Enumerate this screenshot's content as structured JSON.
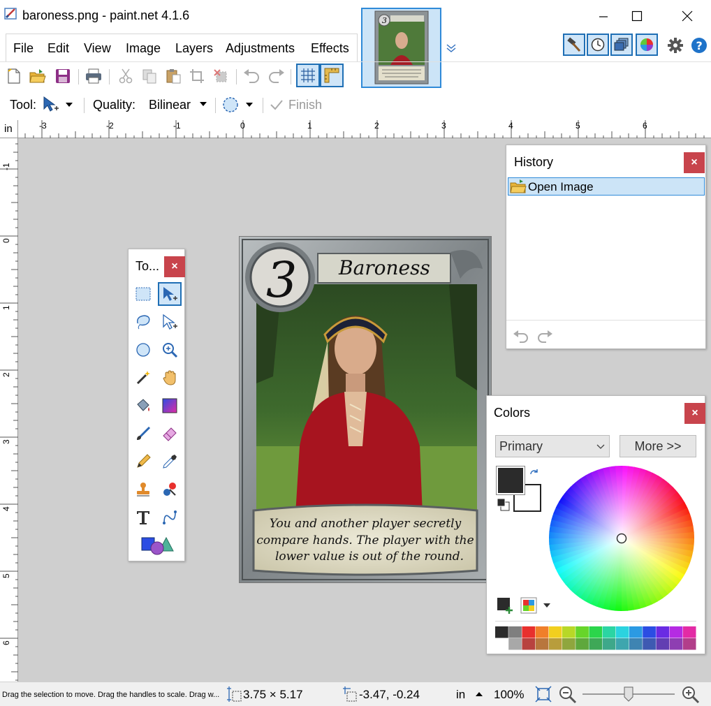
{
  "window": {
    "title": "baroness.png - paint.net 4.1.6",
    "minimize_label": "—",
    "maximize_label": "☐",
    "close_label": "✕"
  },
  "menu": [
    "File",
    "Edit",
    "View",
    "Image",
    "Layers",
    "Adjustments",
    "Effects"
  ],
  "tool_options": {
    "tool_label": "Tool:",
    "quality_label": "Quality:",
    "quality_value": "Bilinear",
    "finish_label": "Finish"
  },
  "ruler": {
    "unit": "in",
    "h_ticks": [
      "-3",
      "-2",
      "-1",
      "0",
      "1",
      "2",
      "3",
      "4",
      "5",
      "6"
    ],
    "v_ticks": [
      "-1",
      "0",
      "1",
      "2",
      "3",
      "4",
      "5",
      "6"
    ]
  },
  "card": {
    "number": "3",
    "name": "Baroness",
    "text_line1": "You and another player secretly",
    "text_line2": "compare hands. The player with the",
    "text_line3": "lower value is out of the round."
  },
  "tools_panel": {
    "title": "To...",
    "close": "×"
  },
  "history_panel": {
    "title": "History",
    "close": "×",
    "items": [
      "Open Image"
    ]
  },
  "colors_panel": {
    "title": "Colors",
    "close": "×",
    "selector_value": "Primary",
    "more_label": "More >>",
    "primary_color": "#2b2b2b",
    "secondary_color": "#ffffff",
    "palette_top": [
      "#2b2b2b",
      "#7f7f7f",
      "#e8302d",
      "#f07f2a",
      "#f2cf1f",
      "#b8d827",
      "#67d52a",
      "#2bd54b",
      "#2bd5a3",
      "#2bd3df",
      "#2b9ae3",
      "#2b4de3",
      "#6a2be3",
      "#b52be3",
      "#e32ba5"
    ],
    "palette_bottom": [
      "#ffffff",
      "#a8a8a8",
      "#b8423f",
      "#b8763d",
      "#b89d3c",
      "#8fa63e",
      "#5fa83d",
      "#3ea857",
      "#3ea88a",
      "#3ea6ae",
      "#3e84b2",
      "#3e5ab2",
      "#623eb2",
      "#8e3eb2",
      "#b23e8a"
    ]
  },
  "status": {
    "hint": "Drag the selection to move. Drag the handles to scale. Drag w...",
    "size": "3.75 × 5.17",
    "position": "-3.47, -0.24",
    "unit": "in",
    "zoom": "100%"
  }
}
